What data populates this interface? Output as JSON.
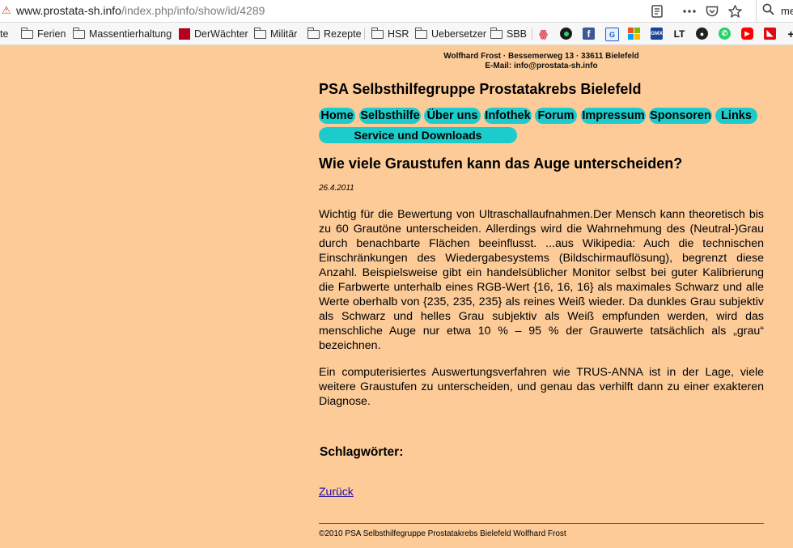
{
  "browser": {
    "url_domain": "www.prostata-sh.info",
    "url_path": "/index.php/info/show/id/4289",
    "search_text": "me",
    "bookmarks": [
      "te",
      "Ferien",
      "Massentierhaltung",
      "DerWächter",
      "Militär",
      "Rezepte",
      "HSR",
      "Uebersetzer",
      "SBB"
    ],
    "bookmark_icons": [
      "fire-icon",
      "dark-icon",
      "facebook-icon",
      "translate-icon",
      "windows-icon",
      "gmx-icon",
      "lt-icon",
      "github-icon",
      "whatsapp-icon",
      "youtube-icon",
      "red-square-icon",
      "plus-icon"
    ]
  },
  "header": {
    "address_line1": "Wolfhard Frost · Bessemerweg 13 · 33611 Bielefeld",
    "address_line2": "E-Mail: info@prostata-sh.info",
    "site_title": "PSA Selbsthilfegruppe Prostatakrebs Bielefeld"
  },
  "nav": {
    "items": [
      "Home",
      "Selbsthilfe",
      "Über uns",
      "Infothek",
      "Forum",
      "Impressum",
      "Sponsoren",
      "Links"
    ],
    "downloads": "Service und Downloads",
    "color": "#1ccccc"
  },
  "article": {
    "title": "Wie viele Graustufen kann das Auge unterscheiden?",
    "date": "26.4.2011",
    "paragraph1": "Wichtig für die Bewertung von Ultraschallaufnahmen.Der Mensch kann theoretisch bis zu 60 Grautöne unterscheiden. Allerdings wird die Wahrnehmung des (Neutral-)Grau durch benachbarte Flächen beeinflusst. ...aus Wikipedia: Auch die technischen Einschränkungen des Wiedergabesystems (Bildschirmauflösung), begrenzt diese Anzahl. Beispielsweise gibt ein handelsüblicher Monitor selbst bei guter Kalibrierung die Farbwerte unterhalb eines RGB-Wert {16, 16, 16} als maximales Schwarz und alle Werte oberhalb von {235, 235, 235} als reines Weiß wieder. Da dunkles Grau subjektiv als Schwarz und helles Grau subjektiv als Weiß empfunden werden, wird das menschliche Auge nur etwa 10 % – 95 % der Grauwerte tatsächlich als „grau“ bezeichnen.",
    "paragraph2": "Ein computerisiertes Auswertungsverfahren wie TRUS-ANNA ist in der Lage, viele weitere Graustufen zu unterscheiden, und genau das verhilft dann zu einer exakteren Diagnose.",
    "tags_label": "Schlagwörter:",
    "back_link": "Zurück"
  },
  "footer": {
    "text": "©2010 PSA Selbsthilfegruppe Prostatakrebs Bielefeld Wolfhard Frost"
  },
  "colors": {
    "page_background": "#fdcb98",
    "nav_button": "#1ccccc"
  }
}
